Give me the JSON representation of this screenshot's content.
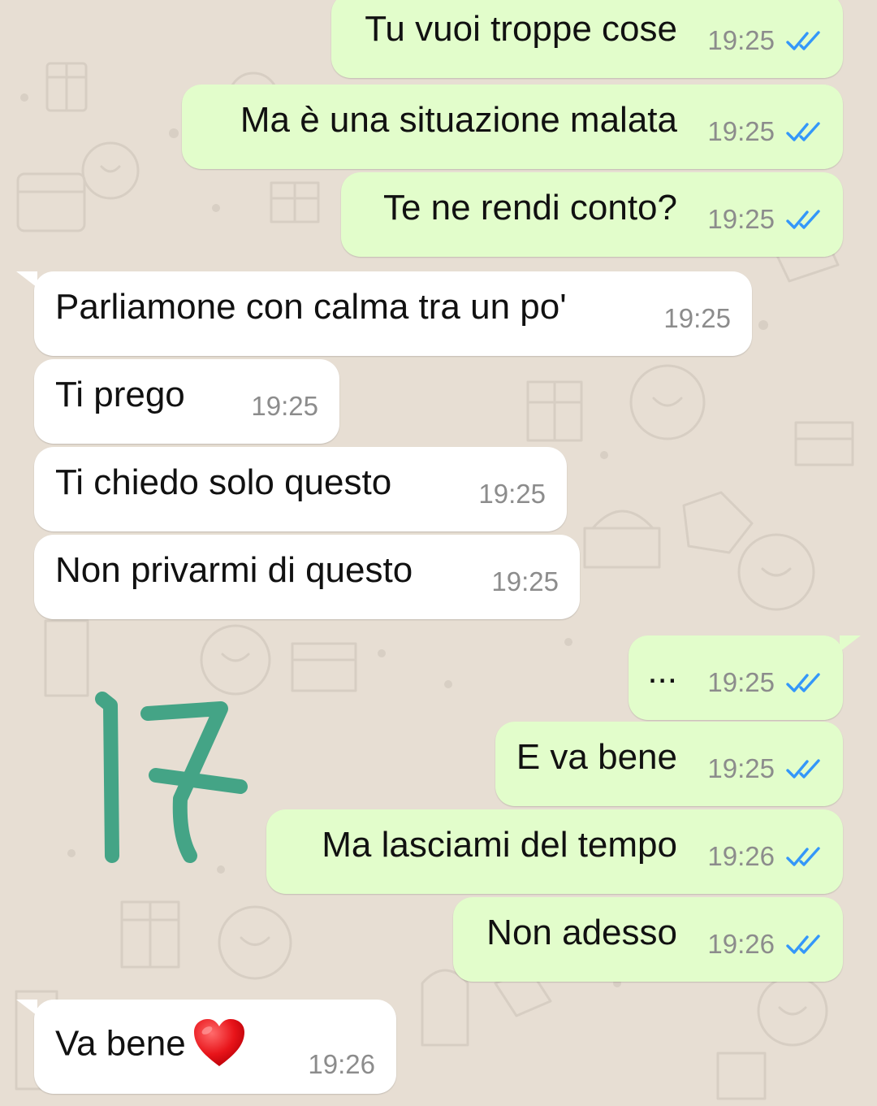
{
  "chat": {
    "messages": [
      {
        "direction": "out",
        "text": "Tu vuoi troppe cose",
        "time": "19:25",
        "status": "read"
      },
      {
        "direction": "out",
        "text": "Ma è una situazione malata",
        "time": "19:25",
        "status": "read"
      },
      {
        "direction": "out",
        "text": "Te ne rendi conto?",
        "time": "19:25",
        "status": "read"
      },
      {
        "direction": "in",
        "text": "Parliamone con calma tra un po'",
        "time": "19:25"
      },
      {
        "direction": "in",
        "text": "Ti prego",
        "time": "19:25"
      },
      {
        "direction": "in",
        "text": "Ti chiedo solo questo",
        "time": "19:25"
      },
      {
        "direction": "in",
        "text": "Non privarmi di questo",
        "time": "19:25"
      },
      {
        "direction": "out",
        "text": "...",
        "time": "19:25",
        "status": "read"
      },
      {
        "direction": "out",
        "text": "E va bene",
        "time": "19:25",
        "status": "read"
      },
      {
        "direction": "out",
        "text": "Ma lasciami del tempo",
        "time": "19:26",
        "status": "read"
      },
      {
        "direction": "out",
        "text": "Non adesso",
        "time": "19:26",
        "status": "read"
      },
      {
        "direction": "in",
        "text": "Va bene",
        "time": "19:26",
        "emoji": "red-heart"
      }
    ]
  },
  "annotation": {
    "text": "17",
    "color": "#44a486"
  },
  "colors": {
    "background": "#e7ded3",
    "outgoing_bubble": "#e2fdcb",
    "incoming_bubble": "#ffffff",
    "read_ticks": "#3497f9",
    "timestamp": "#8c8c8c"
  },
  "icons": {
    "read_status": "double-check-icon",
    "emoji": "heart-emoji"
  }
}
